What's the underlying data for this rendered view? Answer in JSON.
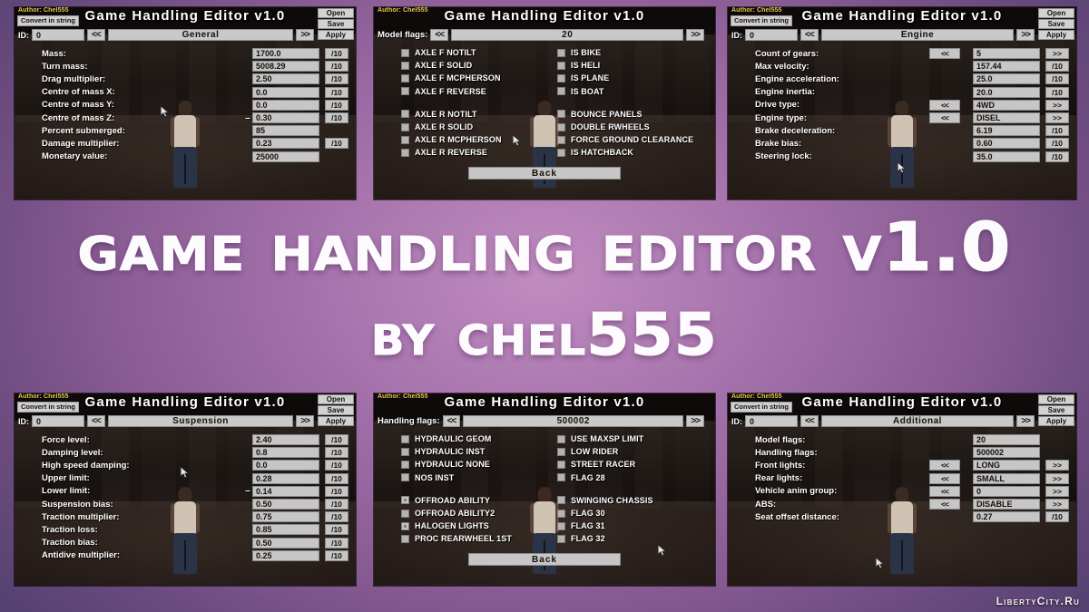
{
  "hero": {
    "title": "Game Handling Editor v1.0",
    "subtitle": "by chel555"
  },
  "watermark": "LibertyCity.Ru",
  "common": {
    "author": "Author: Chel555",
    "convert_button": "Convert in string",
    "app_title": "Game Handling Editor v1.0",
    "top_buttons": {
      "open": "Open",
      "save": "Save",
      "apply": "Apply"
    },
    "id_label": "ID:",
    "id_value": "0",
    "prev_arrow": "<<",
    "next_arrow": ">>",
    "div10": "/10",
    "back_label": "Back",
    "minus": "–"
  },
  "panels": [
    {
      "id": "general",
      "kind": "fields",
      "category": "General",
      "rows": [
        {
          "label": "Mass:",
          "value": "1700.0",
          "suffix": "/10",
          "neg": false,
          "prebtn": ""
        },
        {
          "label": "Turn mass:",
          "value": "5008.29",
          "suffix": "/10",
          "neg": false,
          "prebtn": ""
        },
        {
          "label": "Drag multiplier:",
          "value": "2.50",
          "suffix": "/10",
          "neg": false,
          "prebtn": ""
        },
        {
          "label": "Centre of mass X:",
          "value": "0.0",
          "suffix": "/10",
          "neg": false,
          "prebtn": ""
        },
        {
          "label": "Centre of mass Y:",
          "value": "0.0",
          "suffix": "/10",
          "neg": false,
          "prebtn": ""
        },
        {
          "label": "Centre of mass Z:",
          "value": "0.30",
          "suffix": "/10",
          "neg": true,
          "prebtn": ""
        },
        {
          "label": "Percent submerged:",
          "value": "85",
          "suffix": "",
          "neg": false,
          "prebtn": ""
        },
        {
          "label": "Damage multiplier:",
          "value": "0.23",
          "suffix": "/10",
          "neg": false,
          "prebtn": ""
        },
        {
          "label": "Monetary value:",
          "value": "25000",
          "suffix": "",
          "neg": false,
          "prebtn": ""
        }
      ]
    },
    {
      "id": "model-flags",
      "kind": "flags",
      "flag_label": "Model flags:",
      "flag_value": "20",
      "groups": [
        {
          "left": [
            {
              "label": "AXLE F NOTILT",
              "checked": false
            },
            {
              "label": "AXLE F SOLID",
              "checked": false
            },
            {
              "label": "AXLE F MCPHERSON",
              "checked": false
            },
            {
              "label": "AXLE F REVERSE",
              "checked": false
            }
          ],
          "right": [
            {
              "label": "IS BIKE",
              "checked": false
            },
            {
              "label": "IS HELI",
              "checked": false
            },
            {
              "label": "IS PLANE",
              "checked": false
            },
            {
              "label": "IS BOAT",
              "checked": false
            }
          ]
        },
        {
          "left": [
            {
              "label": "AXLE R NOTILT",
              "checked": false
            },
            {
              "label": "AXLE R SOLID",
              "checked": false
            },
            {
              "label": "AXLE R MCPHERSON",
              "checked": false
            },
            {
              "label": "AXLE R REVERSE",
              "checked": false
            }
          ],
          "right": [
            {
              "label": "BOUNCE PANELS",
              "checked": false
            },
            {
              "label": "DOUBLE RWHEELS",
              "checked": false
            },
            {
              "label": "FORCE GROUND CLEARANCE",
              "checked": false
            },
            {
              "label": "IS HATCHBACK",
              "checked": false
            }
          ]
        }
      ]
    },
    {
      "id": "engine",
      "kind": "fields",
      "category": "Engine",
      "rows": [
        {
          "label": "Count of gears:",
          "value": "5",
          "suffix": ">>",
          "neg": false,
          "prebtn": "<<"
        },
        {
          "label": "Max velocity:",
          "value": "157.44",
          "suffix": "/10",
          "neg": false,
          "prebtn": ""
        },
        {
          "label": "Engine acceleration:",
          "value": "25.0",
          "suffix": "/10",
          "neg": false,
          "prebtn": ""
        },
        {
          "label": "Engine inertia:",
          "value": "20.0",
          "suffix": "/10",
          "neg": false,
          "prebtn": ""
        },
        {
          "label": "Drive type:",
          "value": "4WD",
          "suffix": ">>",
          "neg": false,
          "prebtn": "<<"
        },
        {
          "label": "Engine type:",
          "value": "DISEL",
          "suffix": ">>",
          "neg": false,
          "prebtn": "<<"
        },
        {
          "label": "Brake deceleration:",
          "value": "6.19",
          "suffix": "/10",
          "neg": false,
          "prebtn": ""
        },
        {
          "label": "Brake bias:",
          "value": "0.60",
          "suffix": "/10",
          "neg": false,
          "prebtn": ""
        },
        {
          "label": "Steering lock:",
          "value": "35.0",
          "suffix": "/10",
          "neg": false,
          "prebtn": ""
        }
      ]
    },
    {
      "id": "suspension",
      "kind": "fields",
      "category": "Suspension",
      "rows": [
        {
          "label": "Force level:",
          "value": "2.40",
          "suffix": "/10",
          "neg": false,
          "prebtn": ""
        },
        {
          "label": "Damping level:",
          "value": "0.8",
          "suffix": "/10",
          "neg": false,
          "prebtn": ""
        },
        {
          "label": "High speed damping:",
          "value": "0.0",
          "suffix": "/10",
          "neg": false,
          "prebtn": ""
        },
        {
          "label": "Upper limit:",
          "value": "0.28",
          "suffix": "/10",
          "neg": false,
          "prebtn": ""
        },
        {
          "label": "Lower limit:",
          "value": "0.14",
          "suffix": "/10",
          "neg": true,
          "prebtn": ""
        },
        {
          "label": "Suspension bias:",
          "value": "0.50",
          "suffix": "/10",
          "neg": false,
          "prebtn": ""
        },
        {
          "label": "Traction multiplier:",
          "value": "0.75",
          "suffix": "/10",
          "neg": false,
          "prebtn": ""
        },
        {
          "label": "Traction loss:",
          "value": "0.85",
          "suffix": "/10",
          "neg": false,
          "prebtn": ""
        },
        {
          "label": "Traction bias:",
          "value": "0.50",
          "suffix": "/10",
          "neg": false,
          "prebtn": ""
        },
        {
          "label": "Antidive multiplier:",
          "value": "0.25",
          "suffix": "/10",
          "neg": false,
          "prebtn": ""
        }
      ]
    },
    {
      "id": "handling-flags",
      "kind": "flags",
      "flag_label": "Handling flags:",
      "flag_value": "500002",
      "groups": [
        {
          "left": [
            {
              "label": "HYDRAULIC GEOM",
              "checked": false
            },
            {
              "label": "HYDRAULIC INST",
              "checked": false
            },
            {
              "label": "HYDRAULIC NONE",
              "checked": false
            },
            {
              "label": "NOS INST",
              "checked": false
            }
          ],
          "right": [
            {
              "label": "USE MAXSP LIMIT",
              "checked": false
            },
            {
              "label": "LOW RIDER",
              "checked": false
            },
            {
              "label": "STREET RACER",
              "checked": false
            },
            {
              "label": "FLAG 28",
              "checked": false
            }
          ]
        },
        {
          "left": [
            {
              "label": "OFFROAD ABILITY",
              "checked": true
            },
            {
              "label": "OFFROAD ABILITY2",
              "checked": false
            },
            {
              "label": "HALOGEN LIGHTS",
              "checked": true
            },
            {
              "label": "PROC REARWHEEL 1ST",
              "checked": false
            }
          ],
          "right": [
            {
              "label": "SWINGING CHASSIS",
              "checked": false
            },
            {
              "label": "FLAG 30",
              "checked": false
            },
            {
              "label": "FLAG 31",
              "checked": false
            },
            {
              "label": "FLAG 32",
              "checked": false
            }
          ]
        }
      ]
    },
    {
      "id": "additional",
      "kind": "fields",
      "category": "Additional",
      "rows": [
        {
          "label": "Model flags:",
          "value": "20",
          "suffix": "",
          "neg": false,
          "prebtn": ""
        },
        {
          "label": "Handling flags:",
          "value": "500002",
          "suffix": "",
          "neg": false,
          "prebtn": ""
        },
        {
          "label": "Front lights:",
          "value": "LONG",
          "suffix": ">>",
          "neg": false,
          "prebtn": "<<"
        },
        {
          "label": "Rear lights:",
          "value": "SMALL",
          "suffix": ">>",
          "neg": false,
          "prebtn": "<<"
        },
        {
          "label": "Vehicle anim group:",
          "value": "0",
          "suffix": ">>",
          "neg": false,
          "prebtn": "<<"
        },
        {
          "label": "ABS:",
          "value": "DISABLE",
          "suffix": ">>",
          "neg": false,
          "prebtn": "<<"
        },
        {
          "label": "Seat offset distance:",
          "value": "0.27",
          "suffix": "/10",
          "neg": false,
          "prebtn": ""
        }
      ]
    }
  ]
}
